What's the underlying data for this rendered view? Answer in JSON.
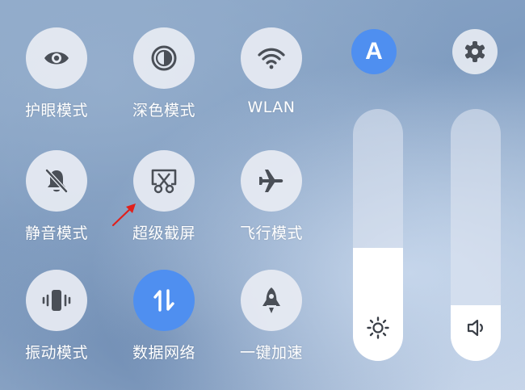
{
  "tiles": [
    {
      "label": "护眼模式",
      "icon": "eye-icon",
      "active": false
    },
    {
      "label": "深色模式",
      "icon": "dark-mode-icon",
      "active": false
    },
    {
      "label": "WLAN",
      "icon": "wifi-icon",
      "active": false
    },
    {
      "label": "静音模式",
      "icon": "bell-off-icon",
      "active": false
    },
    {
      "label": "超级截屏",
      "icon": "screenshot-scissors-icon",
      "active": false
    },
    {
      "label": "飞行模式",
      "icon": "airplane-icon",
      "active": false
    },
    {
      "label": "振动模式",
      "icon": "vibrate-icon",
      "active": false
    },
    {
      "label": "数据网络",
      "icon": "mobile-data-icon",
      "active": true
    },
    {
      "label": "一键加速",
      "icon": "rocket-icon",
      "active": false
    }
  ],
  "auto_brightness": {
    "letter": "A",
    "icon": "auto-brightness-icon",
    "color": "#4f8ff0"
  },
  "settings": {
    "icon": "gear-icon"
  },
  "brightness_slider": {
    "icon": "sun-icon",
    "level": 0.45
  },
  "volume_slider": {
    "icon": "speaker-icon",
    "level": 0.22
  },
  "colors": {
    "accent": "#4f8ff0",
    "icon_dark": "#4a4f57",
    "arrow": "#e0201c"
  }
}
